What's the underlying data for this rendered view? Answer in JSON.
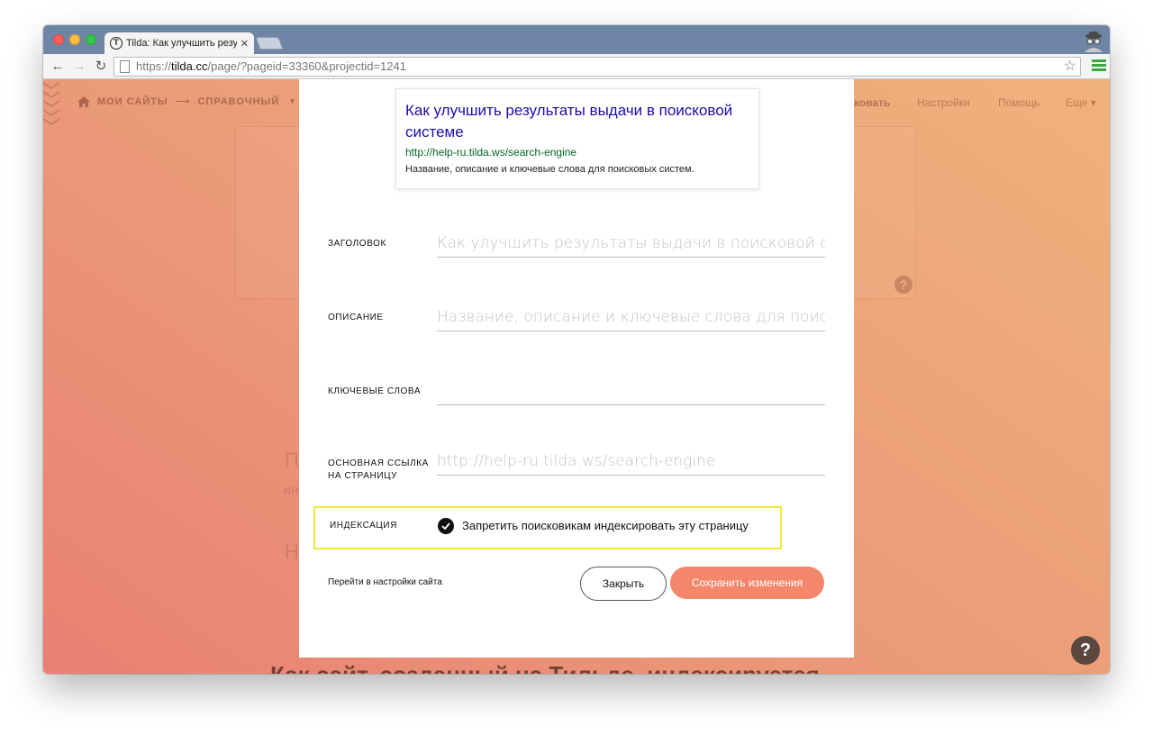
{
  "browser": {
    "tab_title": "Tilda: Как улучшить резул",
    "tab_close": "✕",
    "favicon_letter": "T",
    "url_scheme": "https://",
    "url_host": "tilda.cc",
    "url_path": "/page/?pageid=33360&projectid=1241",
    "star": "☆",
    "back": "←",
    "forward": "→",
    "reload": "↻"
  },
  "site": {
    "nav_left": "МОИ САЙТЫ",
    "nav_arrow": "⟶",
    "nav_current": "СПРАВОЧНЫЙ",
    "nav_caret": "▾",
    "nav_publish_fragment": "ковать",
    "nav_settings": "Настройки",
    "nav_help": "Помощь",
    "nav_more": "Еще ▾",
    "bg_line1": "П",
    "bg_line2": "ин",
    "bg_line3": "Н",
    "bottom_heading": "Как сайт, созданный на Тильде, индексируется",
    "help_fab": "?",
    "bg_help": "?"
  },
  "preview": {
    "title": "Как улучшить результаты выдачи в поисковой системе",
    "url": "http://help-ru.tilda.ws/search-engine",
    "description": "Название, описание и ключевые слова для поисковых систем."
  },
  "form": {
    "title_label": "ЗАГОЛОВОК",
    "title_placeholder": "Как улучшить результаты выдачи в поисковой системе",
    "description_label": "ОПИСАНИЕ",
    "description_placeholder": "Название, описание и ключевые слова для поисковых систем.",
    "keywords_label": "КЛЮЧЕВЫЕ СЛОВА",
    "keywords_placeholder": "",
    "canonical_label_1": "ОСНОВНАЯ ССЫЛКА",
    "canonical_label_2": "НА СТРАНИЦУ",
    "canonical_placeholder": "http://help-ru.tilda.ws/search-engine",
    "indexing_label": "ИНДЕКСАЦИЯ",
    "indexing_checkbox_text": "Запретить поисковикам индексировать эту страницу",
    "indexing_checked": true
  },
  "footer": {
    "settings_link": "Перейти в настройки сайта",
    "close_button": "Закрыть",
    "save_button": "Сохранить изменения"
  },
  "colors": {
    "accent": "#f4876b",
    "highlight_border": "#f4e53c",
    "serp_title": "#1a0dab",
    "serp_url": "#006621"
  }
}
